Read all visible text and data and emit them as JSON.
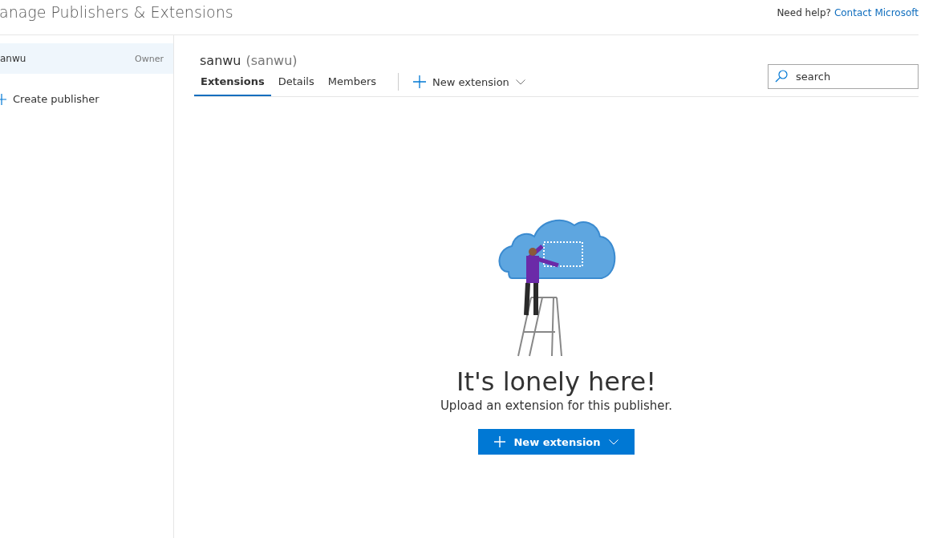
{
  "header": {
    "title": "anage Publishers & Extensions",
    "help_text": "Need help?",
    "help_link": "Contact Microsoft"
  },
  "sidebar": {
    "items": [
      {
        "name": "anwu",
        "role": "Owner",
        "selected": true
      }
    ],
    "create_label": "Create publisher"
  },
  "publisher": {
    "name": "sanwu",
    "id": "(sanwu)"
  },
  "tabs": [
    {
      "label": "Extensions",
      "selected": true
    },
    {
      "label": "Details",
      "selected": false
    },
    {
      "label": "Members",
      "selected": false
    }
  ],
  "toolbar": {
    "new_label": "New extension"
  },
  "search": {
    "placeholder": "search"
  },
  "empty_state": {
    "title": "It's lonely here!",
    "message": "Upload an extension for this publisher.",
    "button": "New extension"
  }
}
